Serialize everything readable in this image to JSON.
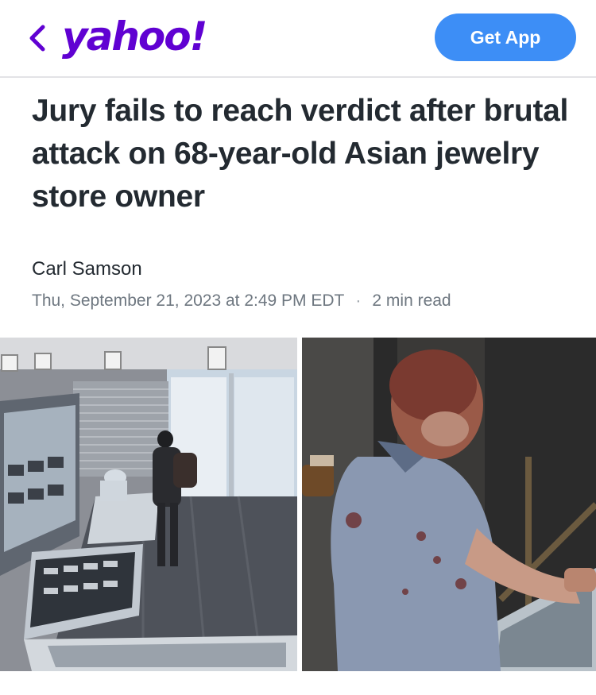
{
  "header": {
    "back_icon": "chevron-left-icon",
    "logo_text": "yahoo!",
    "get_app_label": "Get App",
    "colors": {
      "brand": "#6001d2",
      "button": "#3d8ef6"
    }
  },
  "article": {
    "headline": "Jury fails to reach verdict after brutal attack on 68-year-old Asian jewelry store owner",
    "author": "Carl Samson",
    "date": "Thu, September 21, 2023 at 2:49 PM EDT",
    "separator": "·",
    "read_time": "2 min read"
  },
  "images": [
    {
      "name": "surveillance-image-store-interior"
    },
    {
      "name": "surveillance-image-injured-owner"
    }
  ]
}
